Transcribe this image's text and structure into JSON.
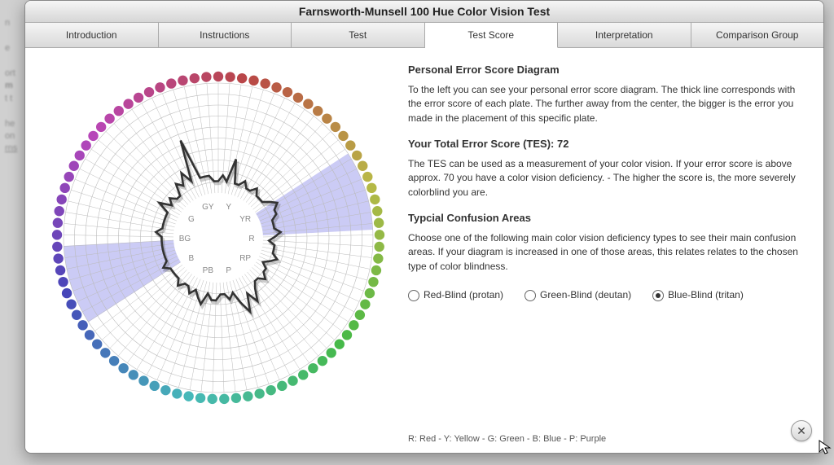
{
  "title": "Farnsworth-Munsell 100 Hue Color Vision Test",
  "tabs": [
    {
      "label": "Introduction",
      "active": false
    },
    {
      "label": "Instructions",
      "active": false
    },
    {
      "label": "Test",
      "active": false
    },
    {
      "label": "Test Score",
      "active": true
    },
    {
      "label": "Interpretation",
      "active": false
    },
    {
      "label": "Comparison Group",
      "active": false
    }
  ],
  "headings": {
    "h1": "Personal Error Score Diagram",
    "h2_prefix": "Your Total Error Score (TES):  ",
    "h3": "Typcial Confusion Areas"
  },
  "paragraphs": {
    "p1": "To the left you can see your personal error score diagram. The thick line corresponds with the error score of each plate. The further away from the center, the bigger is the error you made in the placement of this specific plate.",
    "p2": "The TES can be used as a measurement of your color vision. If your error score is above approx. 70 you have a color vision deficiency. - The higher the score is, the more severely colorblind you are.",
    "p3": "Choose one of the following main color vision deficiency types to see their main confusion areas. If your diagram is increased in one of those areas, this relates relates to the chosen type of color blindness."
  },
  "tes_value": "72",
  "radios": [
    {
      "label": "Red-Blind (protan)",
      "checked": false
    },
    {
      "label": "Green-Blind (deutan)",
      "checked": false
    },
    {
      "label": "Blue-Blind (tritan)",
      "checked": true
    }
  ],
  "legend": "R: Red  -  Y: Yellow  -  G: Green  -  B: Blue  -  P: Purple",
  "close_glyph": "✕",
  "axis_labels": [
    "R",
    "RP",
    "P",
    "PB",
    "B",
    "BG",
    "G",
    "GY",
    "Y",
    "YR"
  ],
  "chart_data": {
    "type": "polar-radar",
    "title": "Personal Error Score Diagram",
    "n_caps": 85,
    "inner_radius": 55,
    "outer_radius": 190,
    "error_scores": [
      2,
      3,
      2,
      6,
      2,
      2,
      3,
      2,
      2,
      3,
      2,
      2,
      2,
      3,
      4,
      3,
      3,
      2,
      2,
      2,
      3,
      2,
      1,
      2,
      2,
      2,
      3,
      2,
      1,
      2,
      2,
      3,
      2,
      2,
      3,
      5,
      3,
      6,
      4,
      2,
      3,
      2,
      2,
      3,
      3,
      2,
      4,
      3,
      2,
      3,
      2,
      2,
      3,
      2,
      2,
      2,
      2,
      3,
      2,
      2,
      2,
      2,
      2,
      2,
      2,
      3,
      2,
      2,
      2,
      2,
      2,
      4,
      2,
      3,
      2,
      2,
      4,
      3,
      5,
      3,
      10,
      3,
      3,
      3,
      2
    ],
    "confusion_wedge": {
      "type": "tritan",
      "center_above_deg": 72,
      "center_below_deg": 252,
      "half_width_deg": 15
    },
    "tes": 72
  }
}
